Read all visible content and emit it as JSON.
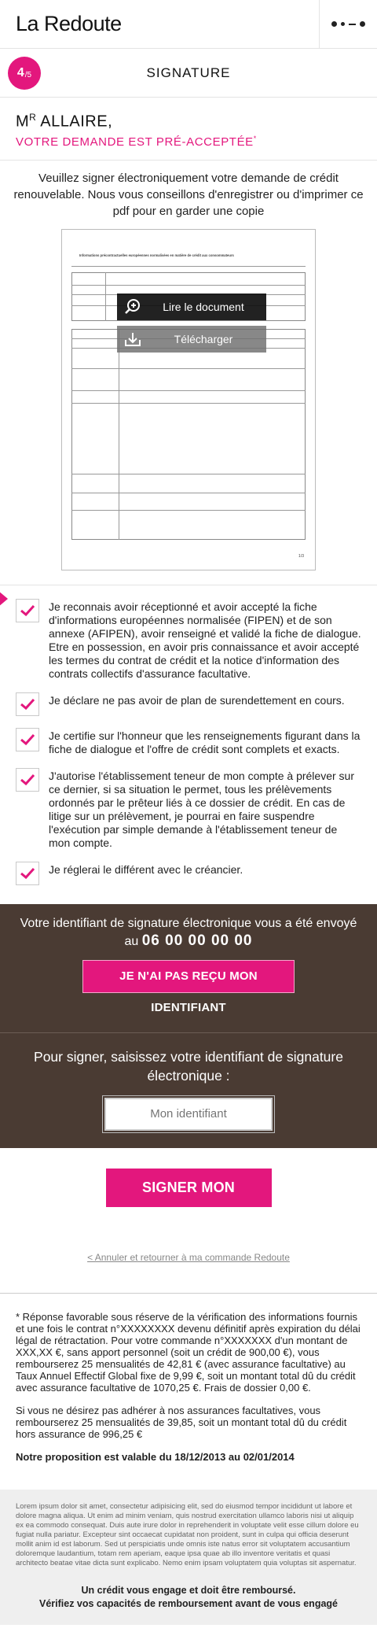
{
  "header": {
    "logo": "La Redoute",
    "menu_icon": "menu-dots-icon"
  },
  "step": {
    "current": "4",
    "total": "/5",
    "title": "SIGNATURE"
  },
  "greeting": {
    "name_prefix": "M",
    "name_sup": "R",
    "name": " ALLAIRE,",
    "subtitle": "VOTRE DEMANDE EST PRÉ-ACCEPTÉE",
    "subtitle_sup": "*"
  },
  "intro": "Veuillez signer électroniquement votre demande de crédit renouvelable. Nous vous conseillons d'enregistrer ou d'imprimer ce pdf pour en garder une copie",
  "document": {
    "read_label": "Lire le document",
    "download_label": "Télécharger",
    "page_label": "1/3",
    "heading": "Informations précontractuelles européennes normalisées en matière de crédit aux consommateurs"
  },
  "checks": [
    {
      "text": "Je reconnais avoir réceptionné et avoir accepté la fiche d'informations européennes normalisée (FIPEN) et de son annexe (AFIPEN), avoir renseigné et validé la fiche de dialogue. Etre en possession, en avoir pris connaissance et avoir accepté les termes du contrat de crédit et la notice d'information des contrats collectifs d'assurance facultative.",
      "checked": true
    },
    {
      "text": "Je déclare ne pas avoir de plan de surendettement en cours.",
      "checked": true
    },
    {
      "text": "Je certifie sur l'honneur que les renseignements figurant dans la fiche de dialogue et l'offre de crédit sont complets et exacts.",
      "checked": true
    },
    {
      "text": "J'autorise l'établissement teneur de mon compte à prélever sur ce dernier, si sa situation le permet, tous les prélèvements ordonnés par le prêteur liés à ce dossier de crédit. En cas de litige sur un prélèvement, je pourrai en faire suspendre l'exécution par simple demande à l'établissement teneur de mon compte.",
      "checked": true
    },
    {
      "text": "Je réglerai le différent avec le créancier.",
      "checked": true
    }
  ],
  "identifier": {
    "sent_label": "Votre identifiant de signature électronique vous a été envoyé au",
    "phone": "06 00 00 00 00",
    "not_received_button": "JE N'AI PAS REÇU MON IDENTIFIANT",
    "prompt": "Pour signer, saisissez votre identifiant de signature électronique :",
    "input_placeholder": "Mon identifiant",
    "input_value": ""
  },
  "sign": {
    "button": "SIGNER MON CONTRAT",
    "back_link": "< Annuler et retourner à ma commande Redoute"
  },
  "legal": {
    "p1": "* Réponse favorable sous réserve de la vérification des informations fournis et une fois le contrat n°XXXXXXXX devenu définitif après expiration du délai légal de rétractation. Pour votre commande n°XXXXXXX d'un montant de XXX,XX €, sans apport personnel (soit un crédit de 900,00 €), vous rembourserez 25 mensualités de 42,81 € (avec assurance facultative) au Taux Annuel Effectif Global fixe de 9,99 €, soit un montant total dû du crédit avec assurance facultative de 1070,25 €. Frais de dossier 0,00 €.",
    "p2": "Si vous ne désirez pas adhérer à nos assurances facultatives, vous rembourserez 25 mensualités de 39,85, soit un montant total dû du crédit hors assurance de 996,25 €",
    "validity": "Notre proposition est valable du 18/12/2013 au 02/01/2014"
  },
  "footer": {
    "lorem": "Lorem ipsum dolor sit amet, consectetur adipisicing elit, sed do eiusmod tempor incididunt ut labore et dolore magna aliqua. Ut enim ad minim veniam, quis nostrud exercitation ullamco laboris nisi ut aliquip ex ea commodo consequat. Duis aute irure dolor in reprehenderit in voluptate velit esse cillum dolore eu fugiat nulla pariatur. Excepteur sint occaecat cupidatat non proident, sunt in culpa qui officia deserunt mollit anim id est laborum. Sed ut perspiciatis unde omnis iste natus error sit voluptatem accusantium doloremque laudantium, totam rem aperiam, eaque ipsa quae ab illo inventore veritatis et quasi architecto beatae vitae dicta sunt explicabo. Nemo enim ipsam voluptatem quia voluptas sit aspernatur.",
    "line1": "Un crédit vous engage et doit être remboursé.",
    "line2": "Vérifiez vos capacités de remboursement avant de vous engagé"
  },
  "colors": {
    "brand_pink": "#e3177d",
    "dark_brown": "#4a3b33"
  }
}
